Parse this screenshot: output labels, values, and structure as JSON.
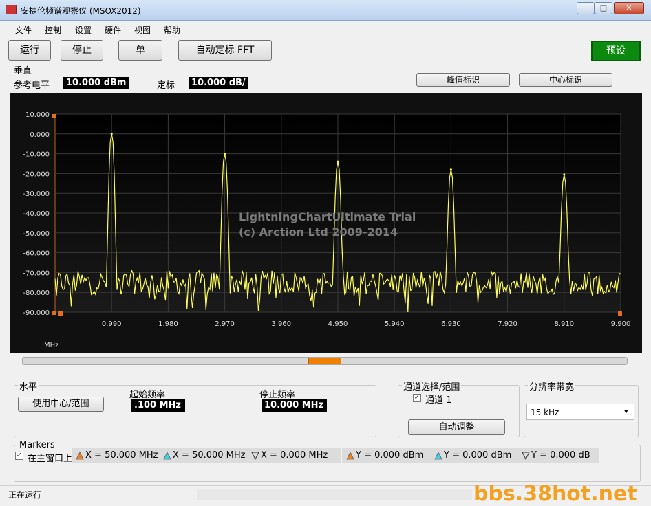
{
  "window": {
    "title": "安捷伦频谱观察仪 (MSOX2012)",
    "min": "−",
    "max": "□",
    "close": "✕"
  },
  "menu": [
    "文件",
    "控制",
    "设置",
    "硬件",
    "视图",
    "帮助"
  ],
  "toolbar": {
    "run": "运行",
    "stop": "停止",
    "single": "单",
    "autoscale": "自动定标 FFT",
    "preset": "预设"
  },
  "vertical": {
    "group": "垂直",
    "ref_label": "参考电平",
    "ref_value": "10.000 dBm",
    "scale_label": "定标",
    "scale_value": "10.000 dB/",
    "peak_btn": "峰值标识",
    "center_btn": "中心标识"
  },
  "chart_data": {
    "type": "line",
    "watermark": [
      "LightningChartUltimate Trial",
      "(c) Arction Ltd 2009-2014"
    ],
    "xunit": "MHz",
    "xlim": [
      0,
      9.9
    ],
    "ylim": [
      -90,
      10
    ],
    "yticks": [
      "10.000",
      "0.000",
      "-10.000",
      "-20.000",
      "-30.000",
      "-40.000",
      "-50.000",
      "-60.000",
      "-70.000",
      "-80.000",
      "-90.000"
    ],
    "xticks": [
      "0.990",
      "1.980",
      "2.970",
      "3.960",
      "4.950",
      "5.940",
      "6.930",
      "7.920",
      "8.910",
      "9.900"
    ],
    "peaks": [
      {
        "x": 0.99,
        "y": 0
      },
      {
        "x": 2.97,
        "y": -10
      },
      {
        "x": 4.95,
        "y": -14
      },
      {
        "x": 6.93,
        "y": -18
      },
      {
        "x": 8.91,
        "y": -20.5
      }
    ],
    "noise_floor": -75,
    "line_color": "#ffff55"
  },
  "horizontal": {
    "group": "水平",
    "use_center_btn": "使用中心/范围",
    "start_label": "起始频率",
    "start_value": ".100 MHz",
    "stop_label": "停止频率",
    "stop_value": "10.000 MHz"
  },
  "channel": {
    "group": "通道选择/范围",
    "ch1_label": "通道 1",
    "check": "✓",
    "auto_btn": "自动调整"
  },
  "rbw": {
    "group": "分辨率带宽",
    "value": "15 kHz",
    "arrow": "▾"
  },
  "markers": {
    "group": "Markers",
    "main_label": "在主窗口上",
    "check": "✓",
    "x1": "X = 50.000 MHz",
    "x2": "X = 50.000 MHz",
    "dx": "X = 0.000 MHz",
    "y1": "Y = 0.000 dBm",
    "y2": "Y = 0.000 dBm",
    "dy": "Y = 0.000 dB",
    "colors": {
      "m1": "#f08020",
      "m2": "#40d0e0"
    }
  },
  "status": {
    "text": "正在运行",
    "watermark": "bbs.38hot.net"
  }
}
